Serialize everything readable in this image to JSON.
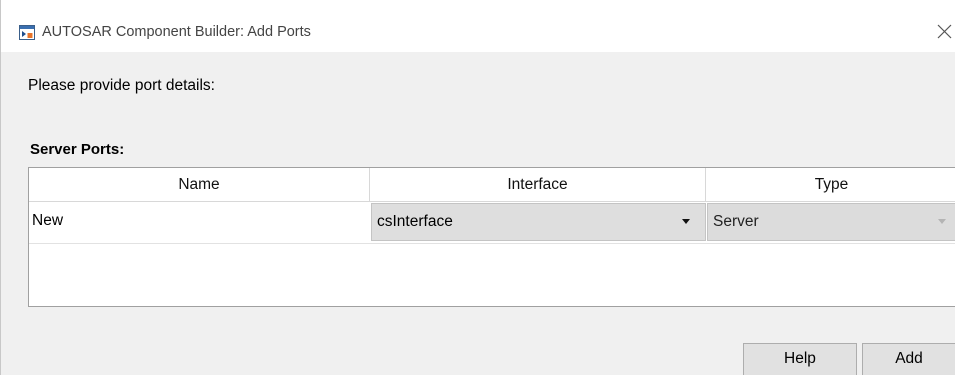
{
  "window": {
    "title": "AUTOSAR Component Builder: Add Ports",
    "icon": "simulink-app-icon",
    "close_icon": "close-icon"
  },
  "prompt": "Please provide port details:",
  "section_label": "Server Ports:",
  "table": {
    "columns": [
      "Name",
      "Interface",
      "Type"
    ],
    "rows": [
      {
        "name": "New",
        "interface": "csInterface",
        "type": "Server"
      }
    ]
  },
  "buttons": {
    "help": "Help",
    "add": "Add"
  }
}
